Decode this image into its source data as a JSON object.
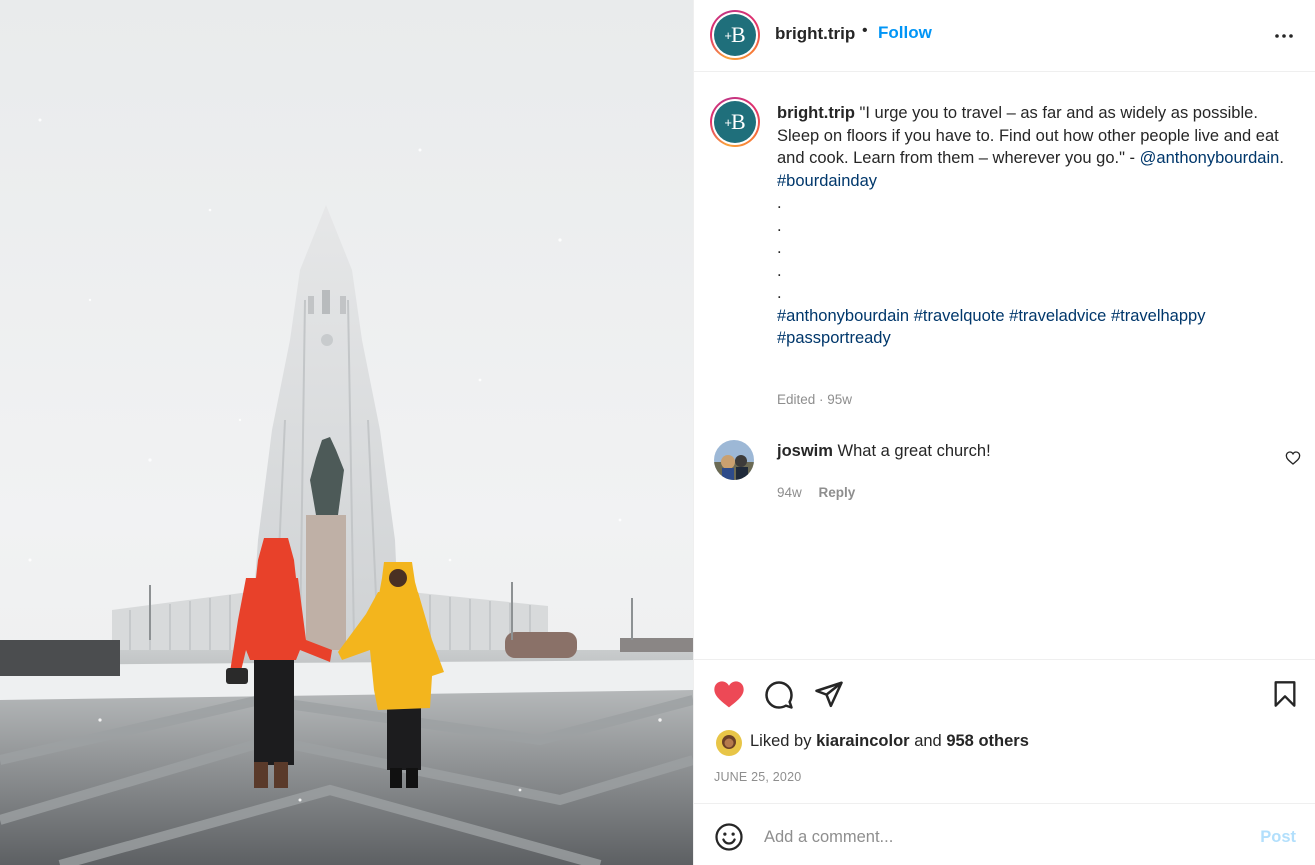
{
  "header": {
    "username": "bright.trip",
    "separator": "•",
    "follow_label": "Follow",
    "more_label": "•••",
    "more_icon": "more-options-icon",
    "avatar_letter": "B",
    "avatar_plus": "+"
  },
  "caption": {
    "username": "bright.trip",
    "text": "\"I urge you to travel – as far and as widely as possible. Sleep on floors if you have to. Find out how other people live and eat and cook. Learn from them – wherever you go.\" -",
    "mention": "@anthonybourdain",
    "mention_trail": ".",
    "hashtag_1": "#bourdainday",
    "dots": [
      ".",
      ".",
      ".",
      ".",
      "."
    ],
    "hashtags": [
      "#anthonybourdain",
      "#travelquote",
      "#traveladvice",
      "#travelhappy",
      "#passportready"
    ],
    "meta": "Edited · 95w"
  },
  "comment": {
    "username": "joswim",
    "text": "What a great church!",
    "age": "94w",
    "reply_label": "Reply",
    "like_icon": "heart-outline-icon"
  },
  "actions": {
    "like_icon": "heart-filled-icon",
    "comment_icon": "comment-icon",
    "share_icon": "share-icon",
    "save_icon": "bookmark-icon",
    "liked_prefix": "Liked by",
    "liked_user": "kiaraincolor",
    "liked_and": "and",
    "liked_others": "958 others",
    "date": "JUNE 25, 2020"
  },
  "comment_bar": {
    "emoji_icon": "emoji-icon",
    "placeholder": "Add a comment...",
    "post_label": "Post"
  },
  "colors": {
    "accent_blue": "#0095f6",
    "link_blue": "#00376b",
    "heart_red": "#ed4956",
    "muted": "#8e8e8e",
    "brand_teal": "#1f6f7b"
  }
}
